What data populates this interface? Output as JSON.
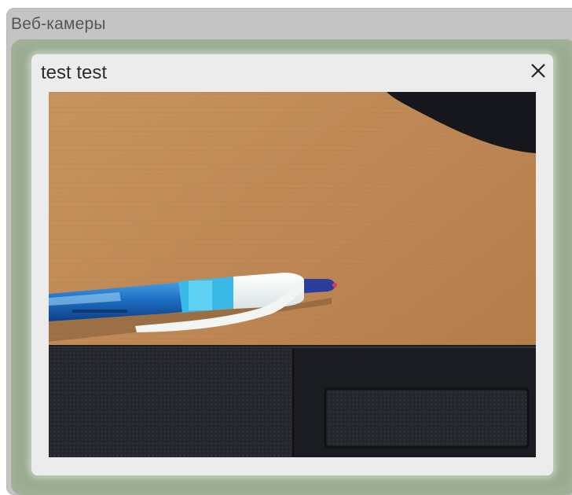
{
  "panel": {
    "title": "Веб-камеры"
  },
  "camera_window": {
    "title": "test test",
    "close_icon": "close-icon"
  },
  "video_feed": {
    "content": "webcam-live-image"
  }
}
